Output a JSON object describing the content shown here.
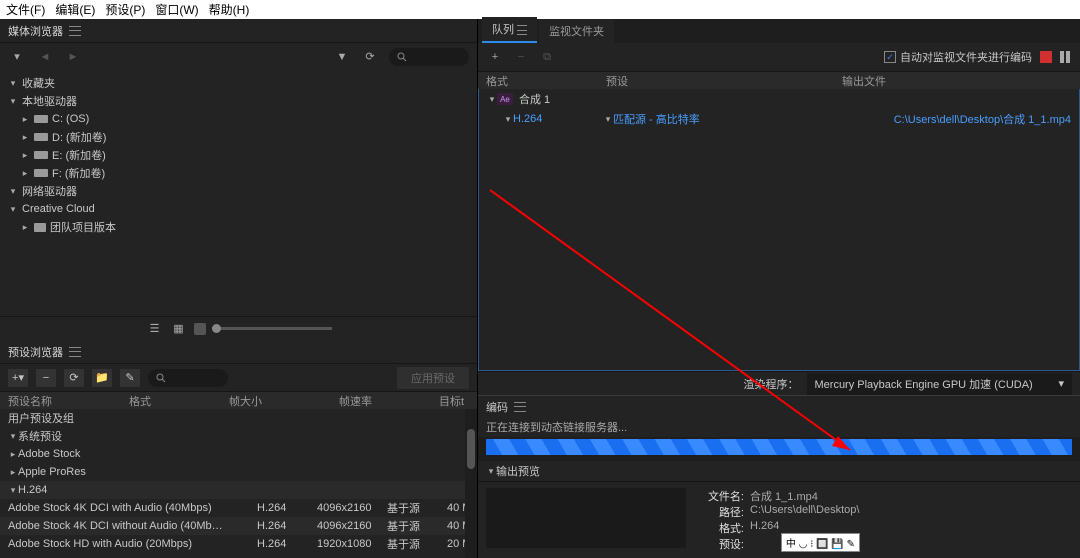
{
  "menu": [
    "文件(F)",
    "编辑(E)",
    "预设(P)",
    "窗口(W)",
    "帮助(H)"
  ],
  "mediaBrowser": {
    "title": "媒体浏览器",
    "favorites": "收藏夹",
    "localDrives": "本地驱动器",
    "drives": [
      "C: (OS)",
      "D: (新加卷)",
      "E: (新加卷)",
      "F: (新加卷)"
    ],
    "networkDrives": "网络驱动器",
    "creativeCloud": "Creative Cloud",
    "teamVersion": "团队项目版本"
  },
  "presetBrowser": {
    "title": "预设浏览器",
    "apply": "应用预设",
    "cols": {
      "name": "预设名称",
      "format": "格式",
      "size": "帧大小",
      "fps": "帧速率",
      "target": "目标t"
    },
    "userGroup": "用户预设及组",
    "sysGroup": "系统预设",
    "nodes": [
      "Adobe Stock",
      "Apple ProRes",
      "H.264"
    ],
    "rows": [
      {
        "name": "Adobe Stock 4K DCI with Audio (40Mbps)",
        "format": "H.264",
        "size": "4096x2160",
        "fps": "基于源",
        "rate": "40 M"
      },
      {
        "name": "Adobe Stock 4K DCI without Audio (40Mb…",
        "format": "H.264",
        "size": "4096x2160",
        "fps": "基于源",
        "rate": "40 M"
      },
      {
        "name": "Adobe Stock HD with Audio (20Mbps)",
        "format": "H.264",
        "size": "1920x1080",
        "fps": "基于源",
        "rate": "20 M"
      }
    ]
  },
  "queue": {
    "tabs": {
      "queue": "队列",
      "watch": "监视文件夹"
    },
    "autoEncode": "自动对监视文件夹进行编码",
    "cols": {
      "format": "格式",
      "preset": "预设",
      "output": "输出文件"
    },
    "comp": "合成 1",
    "format": "H.264",
    "preset": "匹配源 - 高比特率",
    "outfile": "C:\\Users\\dell\\Desktop\\合成 1_1.mp4",
    "renderLabel": "渲染程序：",
    "renderer": "Mercury Playback Engine GPU 加速 (CUDA)"
  },
  "encoding": {
    "title": "编码",
    "msg": "正在连接到动态链接服务器...",
    "preview": "输出预览",
    "kv": {
      "file_k": "文件名:",
      "file_v": "合成 1_1.mp4",
      "path_k": "路径:",
      "path_v": "C:\\Users\\dell\\Desktop\\",
      "fmt_k": "格式:",
      "fmt_v": "H.264",
      "pre_k": "预设:",
      "pre_v": ""
    }
  },
  "ime": "中 ◡ ⁝ 🔲 💾 ✎"
}
